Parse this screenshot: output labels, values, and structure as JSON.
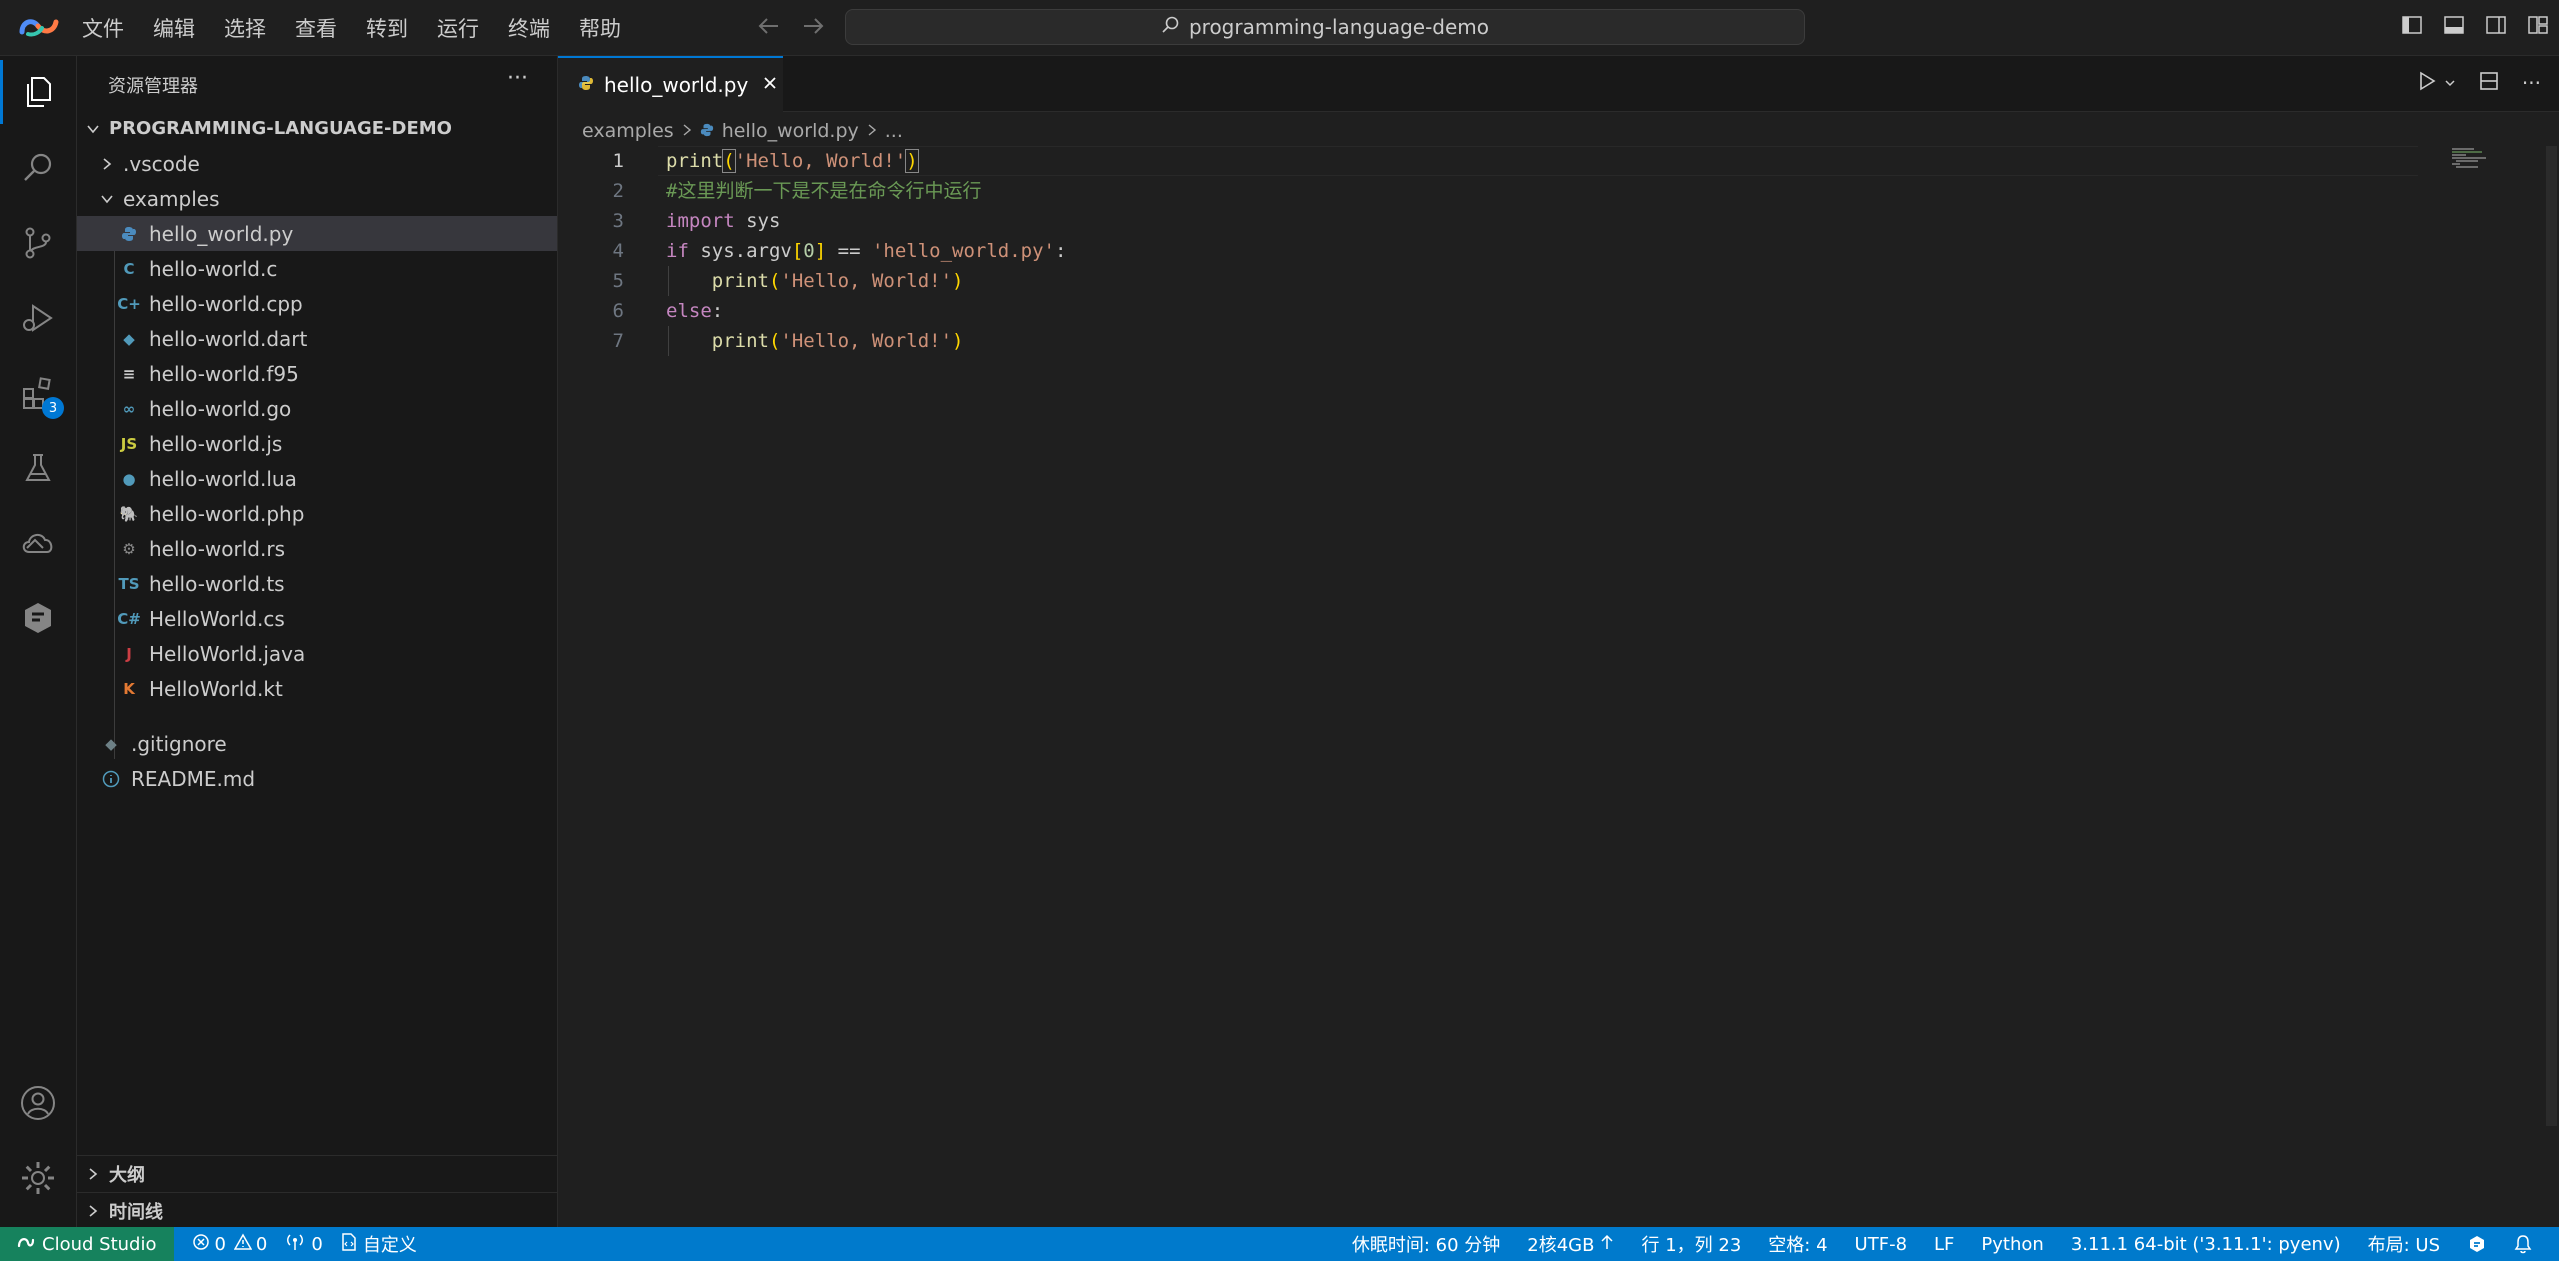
{
  "menu": [
    "文件",
    "编辑",
    "选择",
    "查看",
    "转到",
    "运行",
    "终端",
    "帮助"
  ],
  "command_center": {
    "text": "programming-language-demo"
  },
  "activity_bar": {
    "extensions_badge": "3"
  },
  "sidebar": {
    "title": "资源管理器",
    "root": "PROGRAMMING-LANGUAGE-DEMO",
    "folders": {
      "vscode": ".vscode",
      "examples": "examples"
    },
    "files": [
      {
        "name": "hello_world.py",
        "icon": "python-icon",
        "glyph": "",
        "color": "#4b8bbe",
        "selected": true
      },
      {
        "name": "hello-world.c",
        "icon": "c-icon",
        "glyph": "C",
        "color": "#519aba"
      },
      {
        "name": "hello-world.cpp",
        "icon": "cpp-icon",
        "glyph": "C+",
        "color": "#519aba"
      },
      {
        "name": "hello-world.dart",
        "icon": "dart-icon",
        "glyph": "◆",
        "color": "#519aba"
      },
      {
        "name": "hello-world.f95",
        "icon": "fortran-icon",
        "glyph": "≡",
        "color": "#cccccc"
      },
      {
        "name": "hello-world.go",
        "icon": "go-icon",
        "glyph": "∞",
        "color": "#519aba"
      },
      {
        "name": "hello-world.js",
        "icon": "javascript-icon",
        "glyph": "JS",
        "color": "#cbcb41"
      },
      {
        "name": "hello-world.lua",
        "icon": "lua-icon",
        "glyph": "●",
        "color": "#519aba"
      },
      {
        "name": "hello-world.php",
        "icon": "php-icon",
        "glyph": "🐘",
        "color": "#a074c4"
      },
      {
        "name": "hello-world.rs",
        "icon": "rust-icon",
        "glyph": "⚙",
        "color": "#8a8a8a"
      },
      {
        "name": "hello-world.ts",
        "icon": "typescript-icon",
        "glyph": "TS",
        "color": "#519aba"
      },
      {
        "name": "HelloWorld.cs",
        "icon": "csharp-icon",
        "glyph": "C#",
        "color": "#519aba"
      },
      {
        "name": "HelloWorld.java",
        "icon": "java-icon",
        "glyph": "J",
        "color": "#cc3e44"
      },
      {
        "name": "HelloWorld.kt",
        "icon": "kotlin-icon",
        "glyph": "K",
        "color": "#e37933"
      }
    ],
    "root_files": [
      ".gitignore",
      "README.md"
    ],
    "outline": "大纲",
    "timeline": "时间线"
  },
  "editor": {
    "tab": "hello_world.py",
    "breadcrumbs": [
      "examples",
      "hello_world.py",
      "..."
    ],
    "line_numbers": [
      "1",
      "2",
      "3",
      "4",
      "5",
      "6",
      "7"
    ],
    "code": {
      "l1": {
        "fn": "print",
        "open": "(",
        "str": "'Hello, World!'",
        "close": ")"
      },
      "l2": {
        "comment": "#这里判断一下是不是在命令行中运行"
      },
      "l3": {
        "kw": "import",
        "rest": " sys"
      },
      "l4": {
        "kw": "if",
        "a": " sys.argv",
        "b1": "[",
        "num": "0",
        "b2": "]",
        "op": " == ",
        "str": "'hello_world.py'",
        "colon": ":"
      },
      "l5": {
        "indent": "    ",
        "fn": "print",
        "open": "(",
        "str": "'Hello, World!'",
        "close": ")"
      },
      "l6": {
        "kw": "else",
        "colon": ":"
      },
      "l7": {
        "indent": "    ",
        "fn": "print",
        "open": "(",
        "str": "'Hello, World!'",
        "close": ")"
      }
    }
  },
  "statusbar": {
    "remote": "Cloud Studio",
    "errors": "0",
    "warnings": "0",
    "ports": "0",
    "customize": "自定义",
    "sleep": "休眠时间: 60 分钟",
    "spec": "2核4GB",
    "position": "行 1，列 23",
    "spaces": "空格: 4",
    "encoding": "UTF-8",
    "eol": "LF",
    "language": "Python",
    "interpreter": "3.11.1 64-bit ('3.11.1': pyenv)",
    "layout": "布局: US"
  },
  "colors": {
    "accent": "#0078d4",
    "statusbar": "#007acc",
    "remote": "#16825d"
  }
}
